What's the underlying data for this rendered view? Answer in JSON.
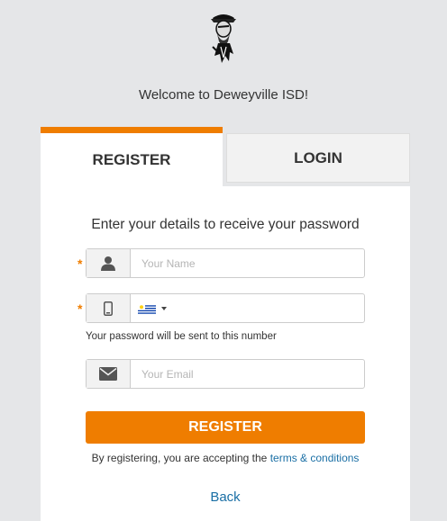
{
  "welcome": "Welcome to Deweyville ISD!",
  "tabs": {
    "register": "REGISTER",
    "login": "LOGIN"
  },
  "form": {
    "instructions": "Enter your details to receive your password",
    "required_marker": "*",
    "name": {
      "placeholder": "Your Name",
      "icon": "user-icon"
    },
    "phone": {
      "value": "",
      "icon": "mobile-phone-icon",
      "country_flag": "uruguay-flag-icon"
    },
    "phone_hint": "Your password will be sent to this number",
    "email": {
      "placeholder": "Your Email",
      "icon": "envelope-icon"
    },
    "submit_label": "REGISTER"
  },
  "terms": {
    "prefix": "By registering, you are accepting the",
    "link": "terms & conditions"
  },
  "back": "Back",
  "colors": {
    "accent": "#ef7d00",
    "link": "#1a6fa5",
    "background": "#e5e6e8"
  }
}
